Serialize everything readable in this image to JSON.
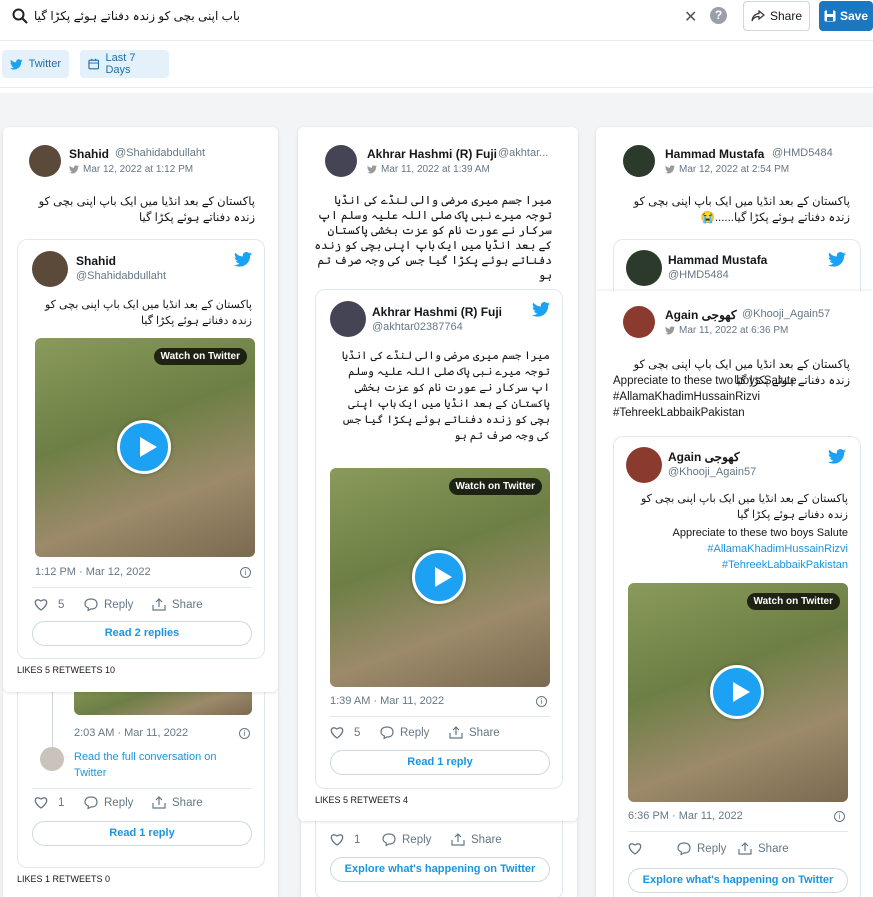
{
  "search": {
    "query": "باب اپنی بچی کو زندہ دفناتے ہوئے پکڑا گیا"
  },
  "toolbar": {
    "share_label": "Share",
    "save_label": "Save"
  },
  "filters": {
    "platform": "Twitter",
    "range": "Last 7 Days"
  },
  "colors": {
    "accent": "#1da1f2",
    "save": "#1a78c2",
    "chip_bg": "#e4f1fb"
  },
  "col1": {
    "name": "Shahid",
    "handle": "@Shahidabdullaht",
    "time": "Mar 12, 2022 at 1:12 PM",
    "text": "پاکستان کے بعد انڈیا میں ایک باپ اپنی بچی کو زندہ دفناتے ہوئے پکڑا گیا",
    "embed": {
      "name": "Shahid",
      "handle": "@Shahidabdullaht",
      "text": "پاکستان کے بعد انڈیا میں ایک باپ  اپنی بچی کو زندہ دفناتے ہوئے پکڑا گیا",
      "watch": "Watch on Twitter",
      "date": "1:12 PM · Mar 12, 2022",
      "likes": "5",
      "reply": "Reply",
      "share": "Share",
      "read": "Read 2 replies"
    },
    "stats": "LIKES 5   RETWEETS 10"
  },
  "col1b": {
    "date": "2:03 AM · Mar 11, 2022",
    "read_full": "Read the full conversation on Twitter",
    "likes": "1",
    "reply": "Reply",
    "share": "Share",
    "read": "Read 1 reply",
    "stats": "LIKES 1   RETWEETS 0"
  },
  "col2": {
    "name": "Akhrar Hashmi (R) Fuji",
    "handle": "@akhtar...",
    "time": "Mar 11, 2022 at 1:39 AM",
    "text": "میرا جسم میری مرضی والی لنڈے کی انڈیا توجہ میرے نبی پاک صلی اللہ علیہ وسلم اپ سرکار نے عورت نام کو عزت بخشی پاکستان کے بعد انڈیا میں ایک باپ اپنی بچی کو زندہ دفناتے ہوئے پکڑا گیا جس کی وجہ صرف تم ہو",
    "embed": {
      "name": "Akhrar Hashmi (R) Fuji",
      "handle": "@akhtar02387764",
      "text": "میرا جسم میری مرضی والی لنڈے کی انڈیا توجہ میرے نبی پاک صلی اللہ علیہ وسلم اپ سرکار نے عورت نام کو عزت بخشی پاکستان کے بعد انڈیا میں ایک باپ  اپنی بچی کو زندہ دفناتے ہوئے پکڑا گیا جس کی وجہ صرف تم ہو",
      "watch": "Watch on Twitter",
      "date": "1:39 AM · Mar 11, 2022",
      "likes": "5",
      "reply": "Reply",
      "share": "Share",
      "read": "Read 1 reply"
    },
    "stats": "LIKES 5   RETWEETS 4",
    "below": {
      "likes": "1",
      "reply": "Reply",
      "share": "Share",
      "explore": "Explore what's happening on Twitter"
    }
  },
  "col3": {
    "name": "Hammad Mustafa",
    "handle": "@HMD5484",
    "time": "Mar 12, 2022 at 2:54 PM",
    "text": "پاکستان کے بعد انڈیا میں ایک باپ اپنی بچی کو زندہ دفناتے ہوئے پکڑا گیا......😭",
    "embed_name": "Hammad Mustafa",
    "embed_handle": "@HMD5484",
    "reply_name": "Again کھوجی",
    "reply_handle": "@Khooji_Again57",
    "reply_time": "Mar 11, 2022 at 6:36 PM",
    "reply_text_urdu": "پاکستان کے بعد انڈیا میں ایک باپ اپنی بچی کو زندہ دفناتے ہوئے پکڑا گیا",
    "reply_text_en": "Appreciate to these two boys Salute #AllamaKhadimHussainRizvi #TehreekLabbaikPakistan",
    "embed2": {
      "name": "Again کھوجی",
      "handle": "@Khooji_Again57",
      "urdu": "پاکستان کے بعد انڈیا میں ایک باپ  اپنی بچی کو زندہ دفناتے ہوئے پکڑا گیا",
      "en": "Appreciate to these two boys Salute",
      "tag1": "#AllamaKhadimHussainRizvi",
      "tag2": "#TehreekLabbaikPakistan",
      "watch": "Watch on Twitter",
      "date": "6:36 PM · Mar 11, 2022",
      "reply": "Reply",
      "share": "Share",
      "explore": "Explore what's happening on Twitter"
    }
  }
}
